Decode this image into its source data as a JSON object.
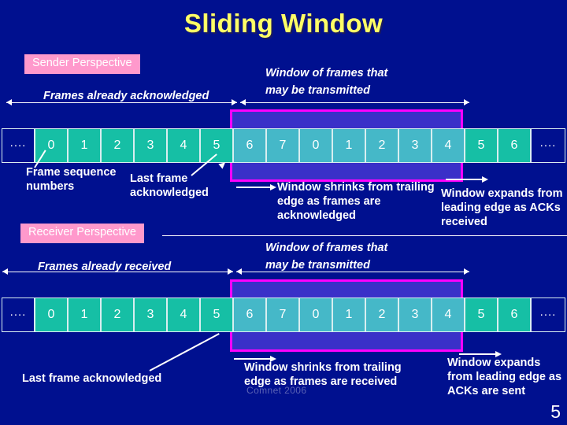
{
  "slide": {
    "title": "Sliding Window",
    "number": "5",
    "watermark": "Comnet 2006",
    "background_color": "#00108F",
    "title_color": "#FFFF66"
  },
  "colors": {
    "badge_bg": "#FF99CC",
    "window_border": "#FF00FF",
    "window_fill": "#3A30C8",
    "frame_outside": "#16BFA5",
    "frame_inside": "#45B8C8"
  },
  "sender": {
    "badge": "Sender Perspective",
    "caption_acknowledged": "Frames already acknowledged",
    "caption_window": "Window of frames that\nmay be transmitted",
    "caption_window_line1": "Window of frames that",
    "caption_window_line2": "may be transmitted",
    "note_sequence": "Frame\nsequence\nnumbers",
    "note_last_ack": "Last frame\nacknowledged",
    "note_shrink": "Window shrinks from\ntrailing edge as frames\nare acknowledged",
    "note_expand": "Window expands\nfrom leading edge\nas ACKs received",
    "frames": [
      {
        "label": "....",
        "state": "ellipsis"
      },
      {
        "label": "0",
        "state": "outside"
      },
      {
        "label": "1",
        "state": "outside"
      },
      {
        "label": "2",
        "state": "outside"
      },
      {
        "label": "3",
        "state": "outside"
      },
      {
        "label": "4",
        "state": "outside"
      },
      {
        "label": "5",
        "state": "outside"
      },
      {
        "label": "6",
        "state": "inside"
      },
      {
        "label": "7",
        "state": "inside"
      },
      {
        "label": "0",
        "state": "inside"
      },
      {
        "label": "1",
        "state": "inside"
      },
      {
        "label": "2",
        "state": "inside"
      },
      {
        "label": "3",
        "state": "inside"
      },
      {
        "label": "4",
        "state": "inside"
      },
      {
        "label": "5",
        "state": "outside"
      },
      {
        "label": "6",
        "state": "outside"
      },
      {
        "label": "....",
        "state": "ellipsis"
      }
    ]
  },
  "receiver": {
    "badge": "Receiver Perspective",
    "caption_acknowledged": "Frames already received",
    "caption_window_line1": "Window of frames that",
    "caption_window_line2": "may be transmitted",
    "note_last_ack": "Last frame acknowledged",
    "note_shrink": "Window shrinks from\ntrailing edge as frames\nare received",
    "note_expand": "Window expands\nfrom leading\nedge as ACKs\nare sent",
    "frames": [
      {
        "label": "....",
        "state": "ellipsis"
      },
      {
        "label": "0",
        "state": "outside"
      },
      {
        "label": "1",
        "state": "outside"
      },
      {
        "label": "2",
        "state": "outside"
      },
      {
        "label": "3",
        "state": "outside"
      },
      {
        "label": "4",
        "state": "outside"
      },
      {
        "label": "5",
        "state": "outside"
      },
      {
        "label": "6",
        "state": "inside"
      },
      {
        "label": "7",
        "state": "inside"
      },
      {
        "label": "0",
        "state": "inside"
      },
      {
        "label": "1",
        "state": "inside"
      },
      {
        "label": "2",
        "state": "inside"
      },
      {
        "label": "3",
        "state": "inside"
      },
      {
        "label": "4",
        "state": "inside"
      },
      {
        "label": "5",
        "state": "outside"
      },
      {
        "label": "6",
        "state": "outside"
      },
      {
        "label": "....",
        "state": "ellipsis"
      }
    ]
  }
}
